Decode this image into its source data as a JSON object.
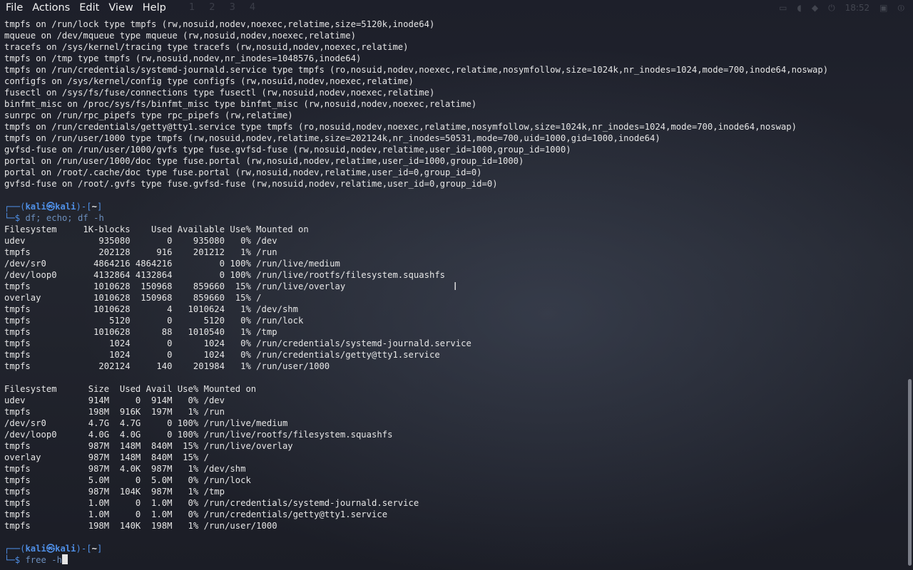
{
  "menu": [
    "File",
    "Actions",
    "Edit",
    "View",
    "Help"
  ],
  "panel_ghost": {
    "workspaces": [
      "1",
      "2",
      "3",
      "4"
    ],
    "clock": "18:52"
  },
  "terminal": {
    "prompt": {
      "user": "kali",
      "at": "㉿",
      "host": "kali",
      "dir": "~"
    },
    "mount_lines": [
      "tmpfs on /run/lock type tmpfs (rw,nosuid,nodev,noexec,relatime,size=5120k,inode64)",
      "mqueue on /dev/mqueue type mqueue (rw,nosuid,nodev,noexec,relatime)",
      "tracefs on /sys/kernel/tracing type tracefs (rw,nosuid,nodev,noexec,relatime)",
      "tmpfs on /tmp type tmpfs (rw,nosuid,nodev,nr_inodes=1048576,inode64)",
      "tmpfs on /run/credentials/systemd-journald.service type tmpfs (ro,nosuid,nodev,noexec,relatime,nosymfollow,size=1024k,nr_inodes=1024,mode=700,inode64,noswap)",
      "configfs on /sys/kernel/config type configfs (rw,nosuid,nodev,noexec,relatime)",
      "fusectl on /sys/fs/fuse/connections type fusectl (rw,nosuid,nodev,noexec,relatime)",
      "binfmt_misc on /proc/sys/fs/binfmt_misc type binfmt_misc (rw,nosuid,nodev,noexec,relatime)",
      "sunrpc on /run/rpc_pipefs type rpc_pipefs (rw,relatime)",
      "tmpfs on /run/credentials/getty@tty1.service type tmpfs (ro,nosuid,nodev,noexec,relatime,nosymfollow,size=1024k,nr_inodes=1024,mode=700,inode64,noswap)",
      "tmpfs on /run/user/1000 type tmpfs (rw,nosuid,nodev,relatime,size=202124k,nr_inodes=50531,mode=700,uid=1000,gid=1000,inode64)",
      "gvfsd-fuse on /run/user/1000/gvfs type fuse.gvfsd-fuse (rw,nosuid,nodev,relatime,user_id=1000,group_id=1000)",
      "portal on /run/user/1000/doc type fuse.portal (rw,nosuid,nodev,relatime,user_id=1000,group_id=1000)",
      "portal on /root/.cache/doc type fuse.portal (rw,nosuid,nodev,relatime,user_id=0,group_id=0)",
      "gvfsd-fuse on /root/.gvfs type fuse.gvfsd-fuse (rw,nosuid,nodev,relatime,user_id=0,group_id=0)"
    ],
    "cmd1": "df; echo; df -h",
    "df_lines": [
      "Filesystem     1K-blocks    Used Available Use% Mounted on",
      "udev              935080       0    935080   0% /dev",
      "tmpfs             202128     916    201212   1% /run",
      "/dev/sr0         4864216 4864216         0 100% /run/live/medium",
      "/dev/loop0       4132864 4132864         0 100% /run/live/rootfs/filesystem.squashfs",
      "tmpfs            1010628  150968    859660  15% /run/live/overlay",
      "overlay          1010628  150968    859660  15% /",
      "tmpfs            1010628       4   1010624   1% /dev/shm",
      "tmpfs               5120       0      5120   0% /run/lock",
      "tmpfs            1010628      88   1010540   1% /tmp",
      "tmpfs               1024       0      1024   0% /run/credentials/systemd-journald.service",
      "tmpfs               1024       0      1024   0% /run/credentials/getty@tty1.service",
      "tmpfs             202124     140    201984   1% /run/user/1000"
    ],
    "dfh_lines": [
      "Filesystem      Size  Used Avail Use% Mounted on",
      "udev            914M     0  914M   0% /dev",
      "tmpfs           198M  916K  197M   1% /run",
      "/dev/sr0        4.7G  4.7G     0 100% /run/live/medium",
      "/dev/loop0      4.0G  4.0G     0 100% /run/live/rootfs/filesystem.squashfs",
      "tmpfs           987M  148M  840M  15% /run/live/overlay",
      "overlay         987M  148M  840M  15% /",
      "tmpfs           987M  4.0K  987M   1% /dev/shm",
      "tmpfs           5.0M     0  5.0M   0% /run/lock",
      "tmpfs           987M  104K  987M   1% /tmp",
      "tmpfs           1.0M     0  1.0M   0% /run/credentials/systemd-journald.service",
      "tmpfs           1.0M     0  1.0M   0% /run/credentials/getty@tty1.service",
      "tmpfs           198M  140K  198M   1% /run/user/1000"
    ],
    "cmd2": "free -h"
  },
  "colors": {
    "prompt_blue": "#4f8fe6",
    "command": "#6c8fbd",
    "text": "#e6e6e6",
    "background": "#1e1f29"
  }
}
